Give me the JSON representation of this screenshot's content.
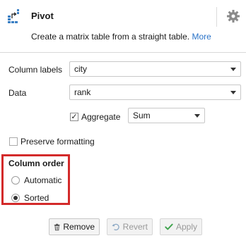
{
  "header": {
    "title": "Pivot",
    "description": "Create a matrix table from a straight table.",
    "more_link": "More",
    "icon": "pivot-icon",
    "settings_icon": "gear-icon"
  },
  "form": {
    "column_labels": {
      "label": "Column labels",
      "value": "city"
    },
    "data": {
      "label": "Data",
      "value": "rank"
    },
    "aggregate": {
      "label": "Aggregate",
      "checked": true,
      "function": "Sum"
    },
    "preserve_formatting": {
      "label": "Preserve formatting",
      "checked": false
    }
  },
  "column_order": {
    "title": "Column order",
    "options": [
      {
        "label": "Automatic",
        "selected": false
      },
      {
        "label": "Sorted",
        "selected": true
      }
    ],
    "highlight_color": "#d32a2a"
  },
  "buttons": {
    "remove": "Remove",
    "revert": "Revert",
    "apply": "Apply"
  },
  "colors": {
    "link": "#2a73c8",
    "apply_check": "#3fa34d"
  }
}
